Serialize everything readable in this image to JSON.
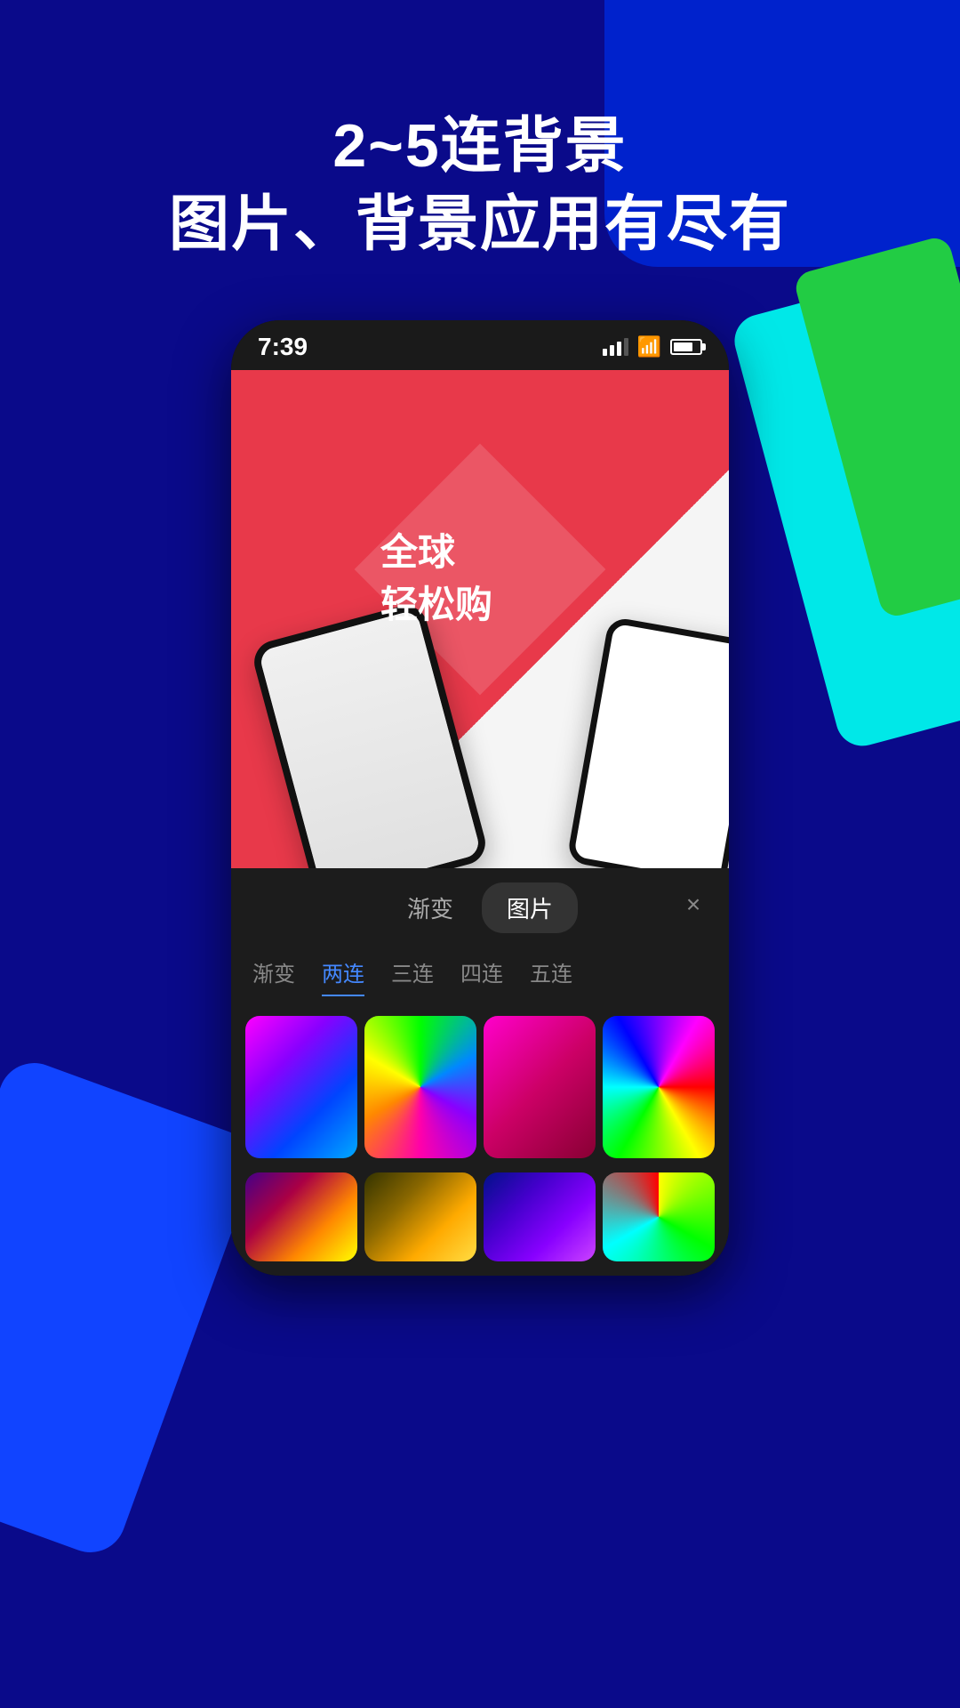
{
  "background": {
    "color": "#0a0a8a"
  },
  "header": {
    "line1": "2~5连背景",
    "line2": "图片、背景应用有尽有"
  },
  "status_bar": {
    "time": "7:39",
    "signal_label": "signal",
    "wifi_label": "wifi",
    "battery_label": "battery"
  },
  "product_card": {
    "text_line1": "全球",
    "text_line2": "轻松购"
  },
  "tab_bar": {
    "tabs": [
      {
        "label": "渐变",
        "active": false
      },
      {
        "label": "图片",
        "active": false
      }
    ],
    "close_label": "×"
  },
  "category_tabs": {
    "items": [
      {
        "label": "渐变",
        "active": false
      },
      {
        "label": "两连",
        "active": true
      },
      {
        "label": "三连",
        "active": false
      },
      {
        "label": "四连",
        "active": false
      },
      {
        "label": "五连",
        "active": false
      }
    ]
  },
  "gradient_items": [
    {
      "id": 1,
      "desc": "purple-blue gradient"
    },
    {
      "id": 2,
      "desc": "conic rainbow gradient"
    },
    {
      "id": 3,
      "desc": "pink gradient"
    },
    {
      "id": 4,
      "desc": "full conic rainbow"
    },
    {
      "id": 5,
      "desc": "dark orange gradient"
    },
    {
      "id": 6,
      "desc": "dark yellow gradient"
    },
    {
      "id": 7,
      "desc": "dark purple gradient"
    },
    {
      "id": 8,
      "desc": "conic partial rainbow"
    }
  ]
}
